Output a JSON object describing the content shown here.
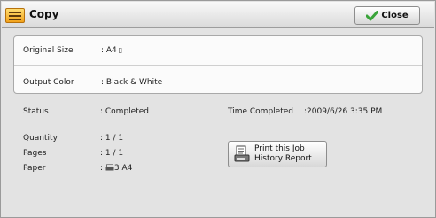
{
  "window": {
    "title": "Copy",
    "close_label": "Close",
    "app_icon": "copy-app-icon",
    "close_icon": "green-check-icon"
  },
  "settings": {
    "original_size_label": "Original Size",
    "original_size_value": ": A4",
    "original_size_glyph": "▯",
    "output_color_label": "Output Color",
    "output_color_value": ": Black & White"
  },
  "job": {
    "status_label": "Status",
    "status_value": ": Completed",
    "time_label": "Time Completed",
    "time_value": ":2009/6/26 3:35 PM",
    "quantity_label": "Quantity",
    "quantity_value": ": 1 / 1",
    "pages_label": "Pages",
    "pages_value": ": 1 / 1",
    "paper_label": "Paper",
    "paper_prefix": ": ",
    "paper_value": "3 A4",
    "paper_icon": "paper-tray-icon"
  },
  "report_button": {
    "line1": "Print this Job",
    "line2": "History Report",
    "icon": "report-printer-icon"
  },
  "colors": {
    "title_gradient_top": "#f9f9f9",
    "title_gradient_bottom": "#dadada",
    "background": "#e3e3e3",
    "panel": "#fbfbfb",
    "check_green": "#3aa43a",
    "icon_orange": "#f2a21c"
  }
}
